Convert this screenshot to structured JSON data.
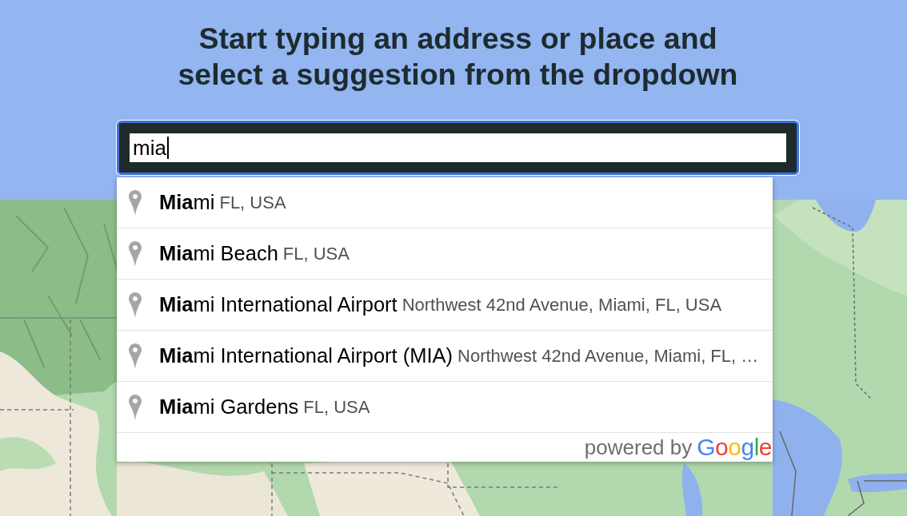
{
  "heading": "Start typing an address or place and select a suggestion from the dropdown",
  "search": {
    "value": "mia",
    "focused": true
  },
  "suggestions": [
    {
      "main": "**Mia**mi",
      "secondary": "FL, USA",
      "selected": false
    },
    {
      "main": "**Mia**mi Beach",
      "secondary": "FL, USA",
      "selected": false
    },
    {
      "main": "**Mia**mi International Airport",
      "secondary": "Northwest 42nd Avenue, Miami, FL, USA",
      "selected": false
    },
    {
      "main": "**Mia**mi International Airport (MIA)",
      "secondary": "Northwest 42nd Avenue, Miami, FL, …",
      "selected": false
    },
    {
      "main": "**Mia**mi Gardens",
      "secondary": "FL, USA",
      "selected": false
    }
  ],
  "attribution": {
    "text": "powered by",
    "logo": "Google"
  }
}
